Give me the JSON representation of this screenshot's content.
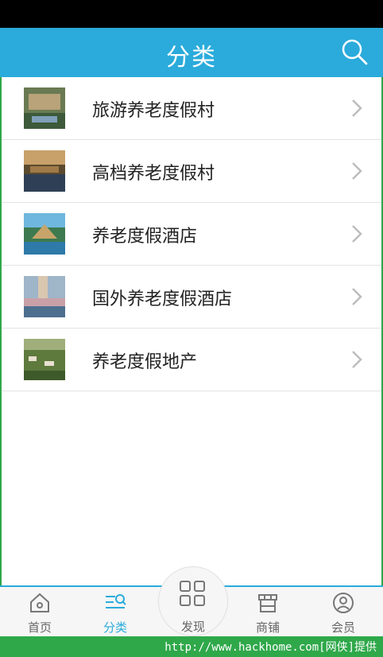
{
  "header": {
    "title": "分类",
    "search_icon": "search-icon"
  },
  "categories": [
    {
      "label": "旅游养老度假村",
      "thumb_colors": [
        "#6a7a52",
        "#b8a37a",
        "#3d5a3a"
      ]
    },
    {
      "label": "高档养老度假村",
      "thumb_colors": [
        "#5b4a2e",
        "#c8a06a",
        "#2f3f55"
      ]
    },
    {
      "label": "养老度假酒店",
      "thumb_colors": [
        "#2e7aa8",
        "#c7a46a",
        "#3d7a4f"
      ]
    },
    {
      "label": "国外养老度假酒店",
      "thumb_colors": [
        "#9fb5c8",
        "#4d6f8f",
        "#d9c7b0"
      ]
    },
    {
      "label": "养老度假地产",
      "thumb_colors": [
        "#5e7a3d",
        "#9fae7a",
        "#3e5a2a"
      ]
    }
  ],
  "tabs": [
    {
      "label": "首页",
      "icon": "home-icon",
      "active": false
    },
    {
      "label": "分类",
      "icon": "category-icon",
      "active": true
    },
    {
      "label": "发现",
      "icon": "discover-grid-icon",
      "active": false
    },
    {
      "label": "商铺",
      "icon": "shop-icon",
      "active": false
    },
    {
      "label": "会员",
      "icon": "member-icon",
      "active": false
    }
  ],
  "watermark": "http://www.hackhome.com[网侠]提供",
  "colors": {
    "accent": "#2aabdb",
    "footer": "#2fa84a"
  }
}
